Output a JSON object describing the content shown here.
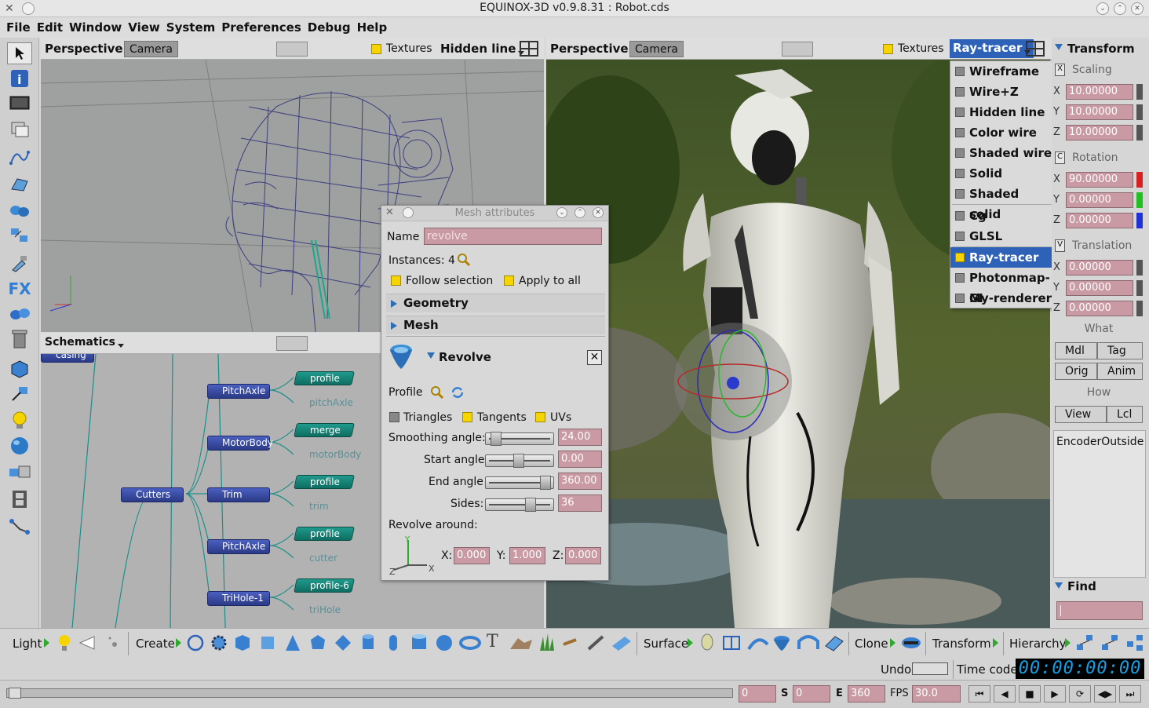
{
  "window": {
    "title": "EQUINOX-3D v0.9.8.31 : Robot.cds"
  },
  "menubar": [
    "File",
    "Edit",
    "Window",
    "View",
    "System",
    "Preferences",
    "Debug",
    "Help"
  ],
  "left_tools": [
    "pointer-icon",
    "info-icon",
    "monitor-icon",
    "cube-stack-icon",
    "curve-icon",
    "shape-icon",
    "cylinder-icon",
    "transform-icon",
    "paint-icon",
    "fx-icon",
    "duplicate-icon",
    "trash-icon",
    "cube-icon",
    "snap-icon",
    "light-icon",
    "sphere-icon",
    "render-icon",
    "film-icon",
    "hierarchy-icon"
  ],
  "viewport1": {
    "mode": "Perspective",
    "camera": "Camera",
    "textures": "Textures",
    "display": "Hidden line"
  },
  "viewport2": {
    "mode": "Perspective",
    "camera": "Camera",
    "textures": "Textures",
    "display": "Ray-tracer"
  },
  "schematics": {
    "title": "Schematics",
    "nodes": {
      "cutters": "Cutters",
      "pitchaxle1": "PitchAxle",
      "motorbody": "MotorBody",
      "trim": "Trim",
      "pitchaxle2": "PitchAxle",
      "trihole": "TriHole-1",
      "casing": "casing"
    },
    "gnodes": [
      "profile",
      "merge",
      "profile",
      "profile",
      "profile-6"
    ],
    "ghosts": [
      "pitchAxle",
      "motorBody",
      "trim",
      "cutter",
      "triHole"
    ]
  },
  "dialog": {
    "title": "Mesh attributes",
    "name_label": "Name",
    "name_value": "revolve",
    "instances_label": "Instances: 4",
    "follow": "Follow selection",
    "apply_all": "Apply to all",
    "geometry": "Geometry",
    "mesh": "Mesh",
    "revolve": "Revolve",
    "profile": "Profile",
    "triangles": "Triangles",
    "tangents": "Tangents",
    "uvs": "UVs",
    "smoothing_label": "Smoothing angle:",
    "smoothing": "24.00",
    "start_label": "Start angle",
    "start": "0.00",
    "end_label": "End angle",
    "end": "360.00",
    "sides_label": "Sides:",
    "sides": "36",
    "around_label": "Revolve around:",
    "x_label": "X:",
    "x": "0.000",
    "y_label": "Y:",
    "y": "1.000",
    "z_label": "Z:",
    "z": "0.000",
    "sliders": {
      "smoothing": 0.08,
      "start": 0.5,
      "end": 0.98,
      "sides": 0.72
    }
  },
  "render_menu": {
    "items": [
      "Wireframe",
      "Wire+Z",
      "Hidden line",
      "Color wire",
      "Shaded wire",
      "Solid",
      "Shaded solid",
      "Cg",
      "GLSL",
      "Ray-tracer",
      "Photonmap-GI",
      "My-renderer"
    ],
    "selected": "Ray-tracer"
  },
  "transform": {
    "title": "Transform",
    "scaling": "Scaling",
    "scaling_key": "X",
    "sx": "10.00000",
    "sy": "10.00000",
    "sz": "10.00000",
    "rotation": "Rotation",
    "rotation_key": "C",
    "rx": "90.00000",
    "ry": "0.00000",
    "rz": "0.00000",
    "translation": "Translation",
    "translation_key": "V",
    "tx": "0.00000",
    "ty": "0.00000",
    "tz": "0.00000",
    "what": "What",
    "mdl": "Mdl",
    "tag": "Tag",
    "orig": "Orig",
    "anim": "Anim",
    "how": "How",
    "view": "View",
    "lcl": "Lcl",
    "encoder": "EncoderOutside",
    "find": "Find",
    "axes": [
      "X",
      "Y",
      "Z"
    ]
  },
  "bottom_toolbar": {
    "light": "Light",
    "create": "Create",
    "surface": "Surface",
    "clone": "Clone",
    "transform": "Transform",
    "hierarchy": "Hierarchy"
  },
  "status": {
    "undo": "Undo",
    "timecode_label": "Time code",
    "timecode": "00:00:00:00"
  },
  "timeline": {
    "current": "0",
    "s_label": "S",
    "start": "0",
    "e_label": "E",
    "end": "360",
    "fps_label": "FPS",
    "fps": "30.0"
  },
  "colors": {
    "accent": "#2d62b8",
    "input_pink": "#c99aa3",
    "node_blue": "#3a4fa8",
    "node_teal": "#17877a",
    "timecode": "#12a0e6"
  }
}
